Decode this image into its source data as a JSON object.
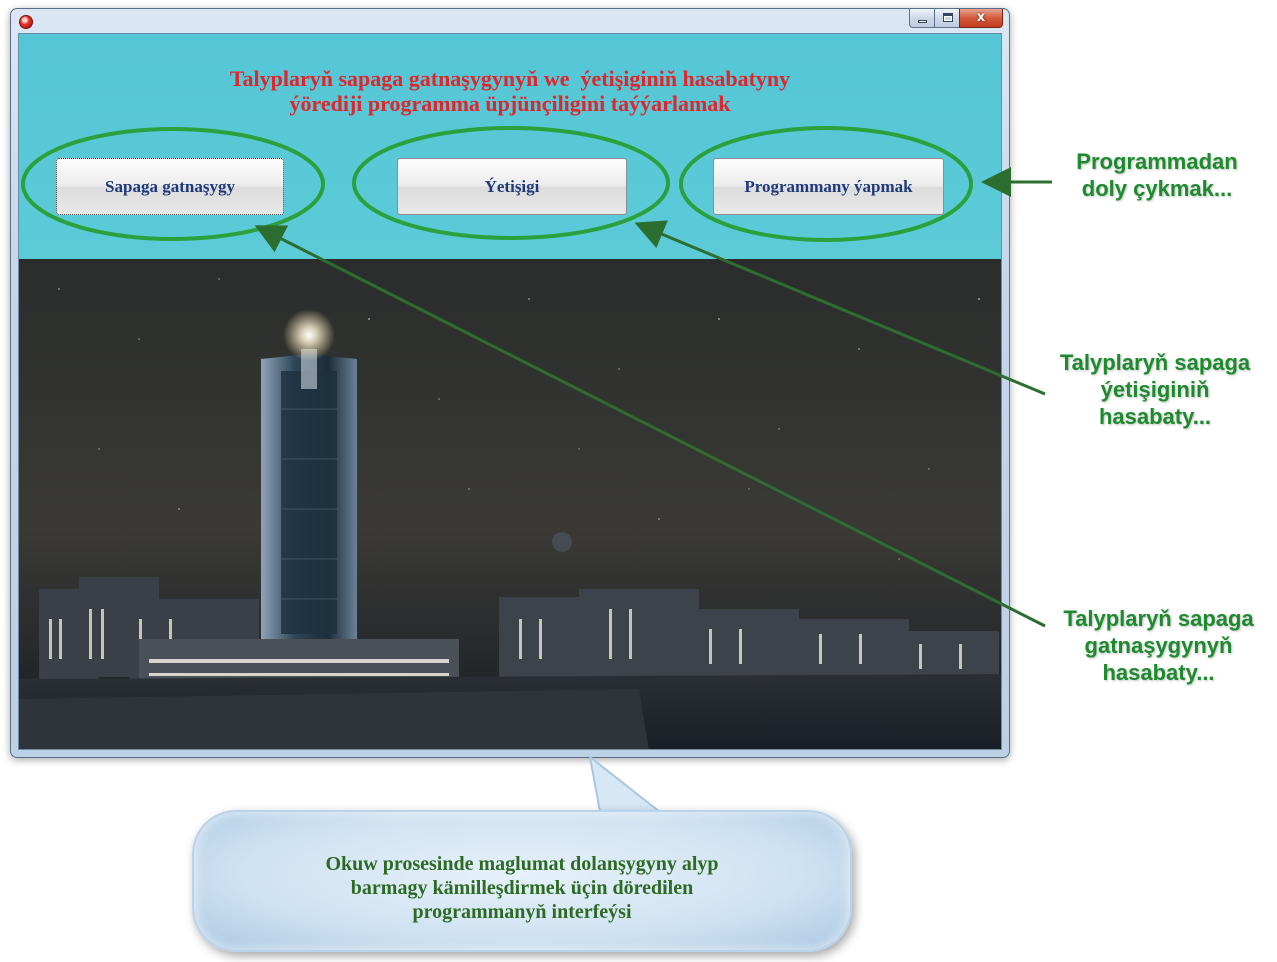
{
  "window": {
    "title_icon": "app-icon",
    "controls": [
      "minimize-icon",
      "maximize-icon",
      "close-icon"
    ],
    "close_glyph": "x"
  },
  "app": {
    "title": "Talyplaryň sapaga gatnaşygynyň we  ýetişiginiň hasabatyny\nýörediji programma üpjünçiligini taýýarlamak",
    "buttons": {
      "attendance": "Sapaga gatnaşygy",
      "progress": "Ýetişigi",
      "close_program": "Programmany ýapmak"
    }
  },
  "annotations": {
    "exit": "Programmadan\ndoly çykmak...",
    "progress_report": "Talyplaryň sapaga\nýetişiginiň\nhasabaty...",
    "attendance_report": "Talyplaryň sapaga\ngatnaşygynyň\nhasabaty...",
    "caption": "Okuw prosesinde maglumat dolanşygyny alyp\nbarmagy kämilleşdirmek üçin döredilen\nprogrammanyň interfeýsi"
  },
  "colors": {
    "title_red": "#e0252b",
    "button_text": "#1f3a7a",
    "annotation_green": "#1e8a2e",
    "panel_cyan": "#5bc8d6",
    "caption_green": "#2d6a24"
  }
}
